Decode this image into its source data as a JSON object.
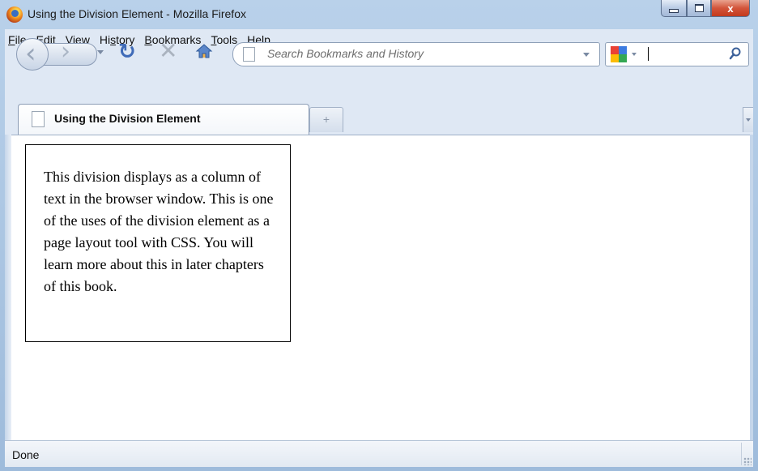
{
  "window": {
    "title": "Using the Division Element - Mozilla Firefox",
    "minimize_icon": "minimize-icon",
    "maximize_icon": "maximize-icon",
    "close_label": "x"
  },
  "menubar": {
    "items": [
      {
        "label": "File",
        "accel": "F",
        "rest": "ile"
      },
      {
        "label": "Edit",
        "accel": "E",
        "rest": "dit"
      },
      {
        "label": "View",
        "accel": "V",
        "rest": "iew"
      },
      {
        "label": "History",
        "pre": "Hi",
        "accel": "s",
        "rest": "tory"
      },
      {
        "label": "Bookmarks",
        "accel": "B",
        "rest": "ookmarks"
      },
      {
        "label": "Tools",
        "accel": "T",
        "rest": "ools"
      },
      {
        "label": "Help",
        "accel": "H",
        "rest": "elp"
      }
    ]
  },
  "navbar": {
    "icons": [
      "back-icon",
      "forward-icon",
      "reload-icon",
      "stop-icon",
      "home-icon"
    ],
    "url_placeholder": "Search Bookmarks and History",
    "search_icon": "magnifier-icon",
    "search_engine_icon": "google-icon"
  },
  "tabs": {
    "items": [
      {
        "label": "Using the Division Element"
      }
    ],
    "new_tab_label": "+"
  },
  "page": {
    "division_text": "This division displays as a column of text in the browser window. This is one of the uses of the division element as a page layout tool with CSS. You will learn more about this in later chapters of this book."
  },
  "status": {
    "text": "Done"
  },
  "colors": {
    "titlebar": "#b9d1ea",
    "close_button": "#c33a1c",
    "chrome": "#dfe8f4"
  }
}
